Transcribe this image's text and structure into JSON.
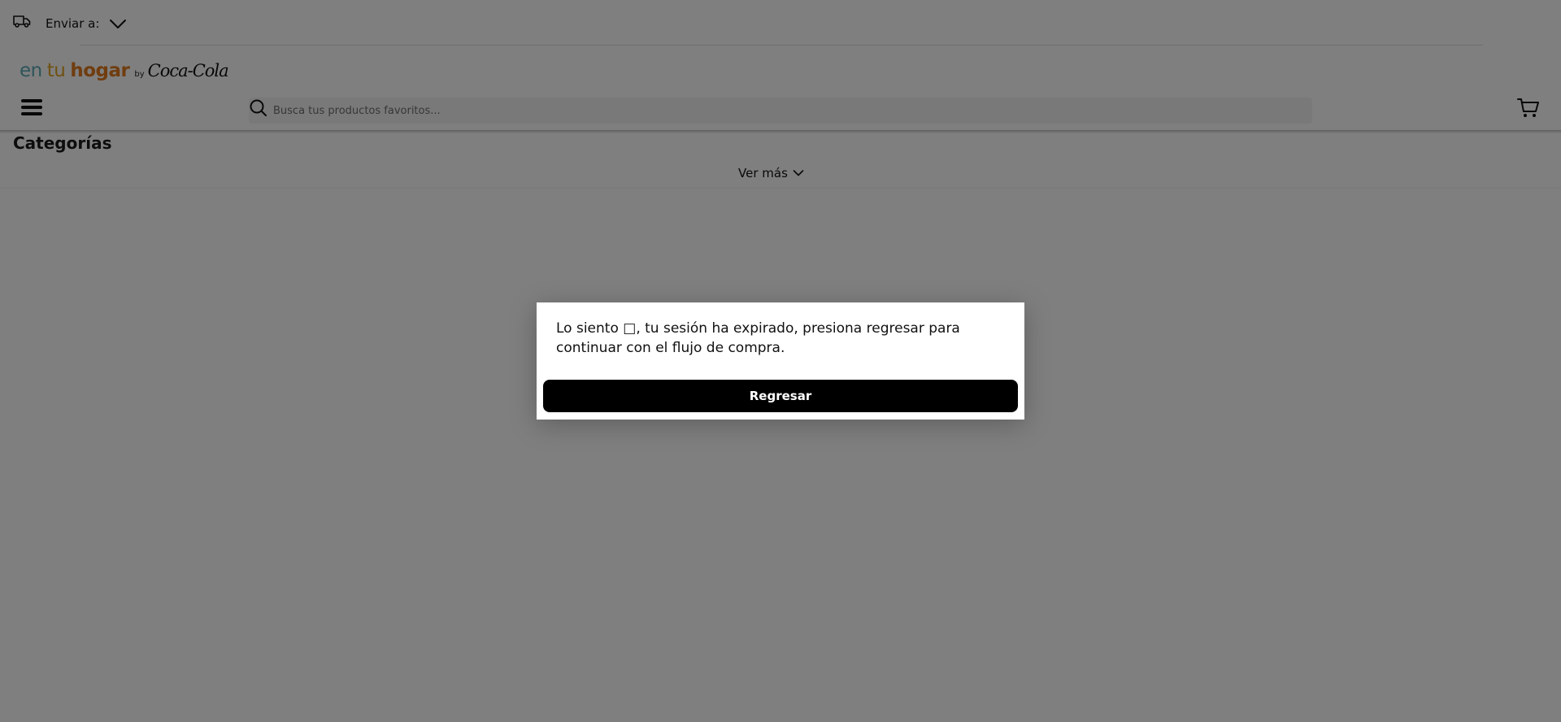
{
  "shipping": {
    "label": "Enviar a:"
  },
  "logo": {
    "part1": "en",
    "part2": "tu",
    "part3": "hogar",
    "by": "by",
    "brand": "Coca-Cola"
  },
  "search": {
    "placeholder": "Busca tus productos favoritos..."
  },
  "categories": {
    "title": "Categorías",
    "see_more": "Ver más"
  },
  "modal": {
    "message": "Lo siento □, tu sesión ha expirado, presiona regresar para continuar con el flujo de compra.",
    "button_label": "Regresar"
  },
  "colors": {
    "logo_en": "#5aa9b5",
    "logo_tu": "#e0a224",
    "logo_hogar": "#e07a1f",
    "button_bg": "#000000",
    "overlay": "rgba(0,0,0,0.5)"
  },
  "icons": {
    "shipping": "truck-icon",
    "shipping_dropdown": "chevron-down-icon",
    "menu": "hamburger-menu-icon",
    "search": "search-icon",
    "cart": "cart-icon",
    "see_more": "chevron-down-icon"
  }
}
